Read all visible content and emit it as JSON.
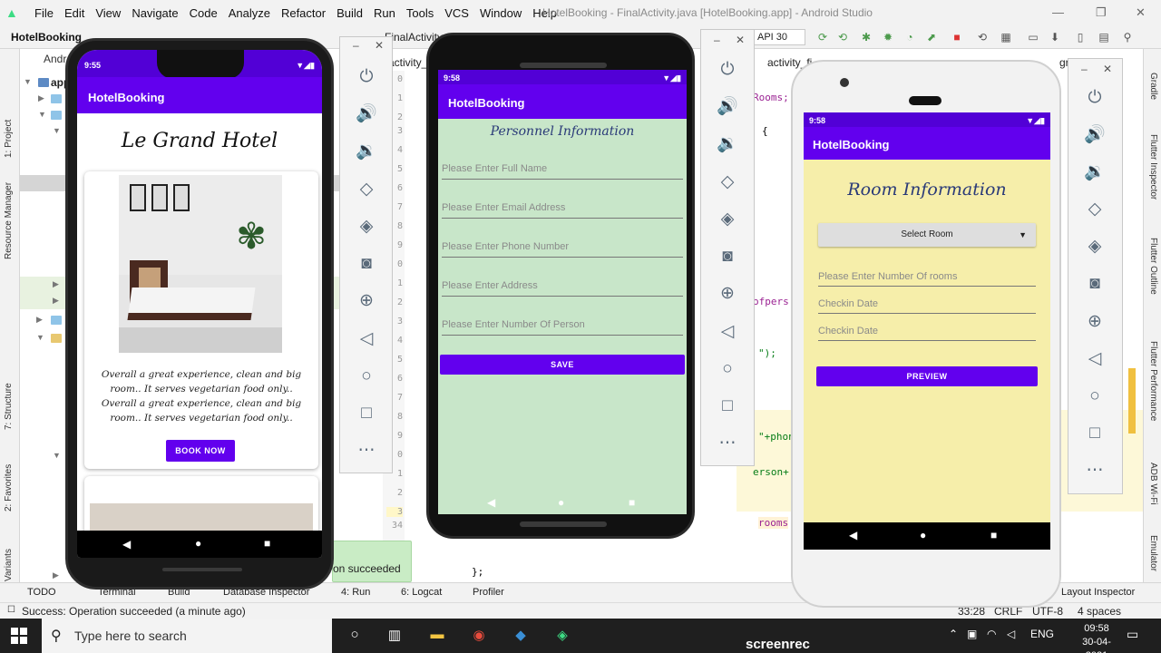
{
  "ide": {
    "menu": [
      "File",
      "Edit",
      "View",
      "Navigate",
      "Code",
      "Analyze",
      "Refactor",
      "Build",
      "Run",
      "Tools",
      "VCS",
      "Window",
      "Help"
    ],
    "window_title": "HotelBooking - FinalActivity.java [HotelBooking.app] - Android Studio",
    "project_name": "HotelBooking",
    "file_tab": "FinalActivity",
    "api_level": "API 30",
    "tree_header": "Andr",
    "tree_app": "app",
    "editor_tab": "activity_ro",
    "editor_tab_2": "activity_fi",
    "gradle_tab": "gradle",
    "left_tools": [
      "1: Project",
      "Resource Manager",
      "7: Structure",
      "2: Favorites",
      "Build Variants"
    ],
    "right_tools": [
      "Gradle",
      "Flutter Inspector",
      "Flutter Outline",
      "Flutter Performance",
      "ADB Wi-Fi",
      "Emulator"
    ],
    "line_numbers": [
      "0",
      "1",
      "2",
      "3",
      "4",
      "5",
      "6",
      "7",
      "8",
      "9",
      "0",
      "1",
      "2",
      "3",
      "4",
      "5",
      "6",
      "7",
      "8",
      "9",
      "0",
      "1",
      "2",
      "3",
      "34",
      "35",
      "36",
      "37"
    ],
    "code_snippets": {
      "rooms": "Rooms;",
      "brace": "{",
      "ofpers": "ofpers",
      "quote": "\");",
      "phon": "\"+phon",
      "person": "erson+",
      "rooms2": "rooms",
      "end": "};"
    },
    "bottom_tools": [
      "TODO",
      "Terminal",
      "Build",
      "Database Inspector",
      "4: Run",
      "6: Logcat",
      "Profiler",
      "Layout Inspector"
    ],
    "status_text": "Success: Operation succeeded (a minute ago)",
    "status_right": [
      "33:28",
      "CRLF",
      "UTF-8",
      "4 spaces"
    ],
    "toast": "on succeeded"
  },
  "taskbar": {
    "search_placeholder": "Type here to search",
    "brand": "screenrec",
    "lang": "ENG",
    "time": "09:58",
    "date": "30-04-2021"
  },
  "phone1": {
    "status_time": "9:55",
    "app_title": "HotelBooking",
    "hotel_name": "Le Grand Hotel",
    "description": "Overall a great experience, clean and big room.. It serves vegetarian food only.. Overall a great experience, clean and big room.. It serves vegetarian food only..",
    "button": "BOOK NOW",
    "accent": "#6200ee",
    "appbar_color": "#6200ee"
  },
  "phone2": {
    "status_time": "9:58",
    "app_title": "HotelBooking",
    "heading": "Personnel Information",
    "fields": [
      "Please Enter Full Name",
      "Please Enter Email Address",
      "Please Enter Phone Number",
      "Please Enter Address",
      "Please Enter Number Of Person"
    ],
    "button": "SAVE",
    "bg_color": "#c8e6c9"
  },
  "phone3": {
    "status_time": "9:58",
    "app_title": "HotelBooking",
    "heading": "Room Information",
    "spinner": "Select Room",
    "fields": [
      "Please Enter Number Of rooms",
      "Checkin Date",
      "Checkin Date"
    ],
    "button": "PREVIEW",
    "bg_color": "#f6eeaa"
  },
  "emulator_controls": [
    "power-icon",
    "volume-up-icon",
    "volume-down-icon",
    "rotate-left-icon",
    "rotate-right-icon",
    "camera-icon",
    "zoom-icon",
    "back-icon",
    "home-icon",
    "overview-icon",
    "more-icon"
  ]
}
